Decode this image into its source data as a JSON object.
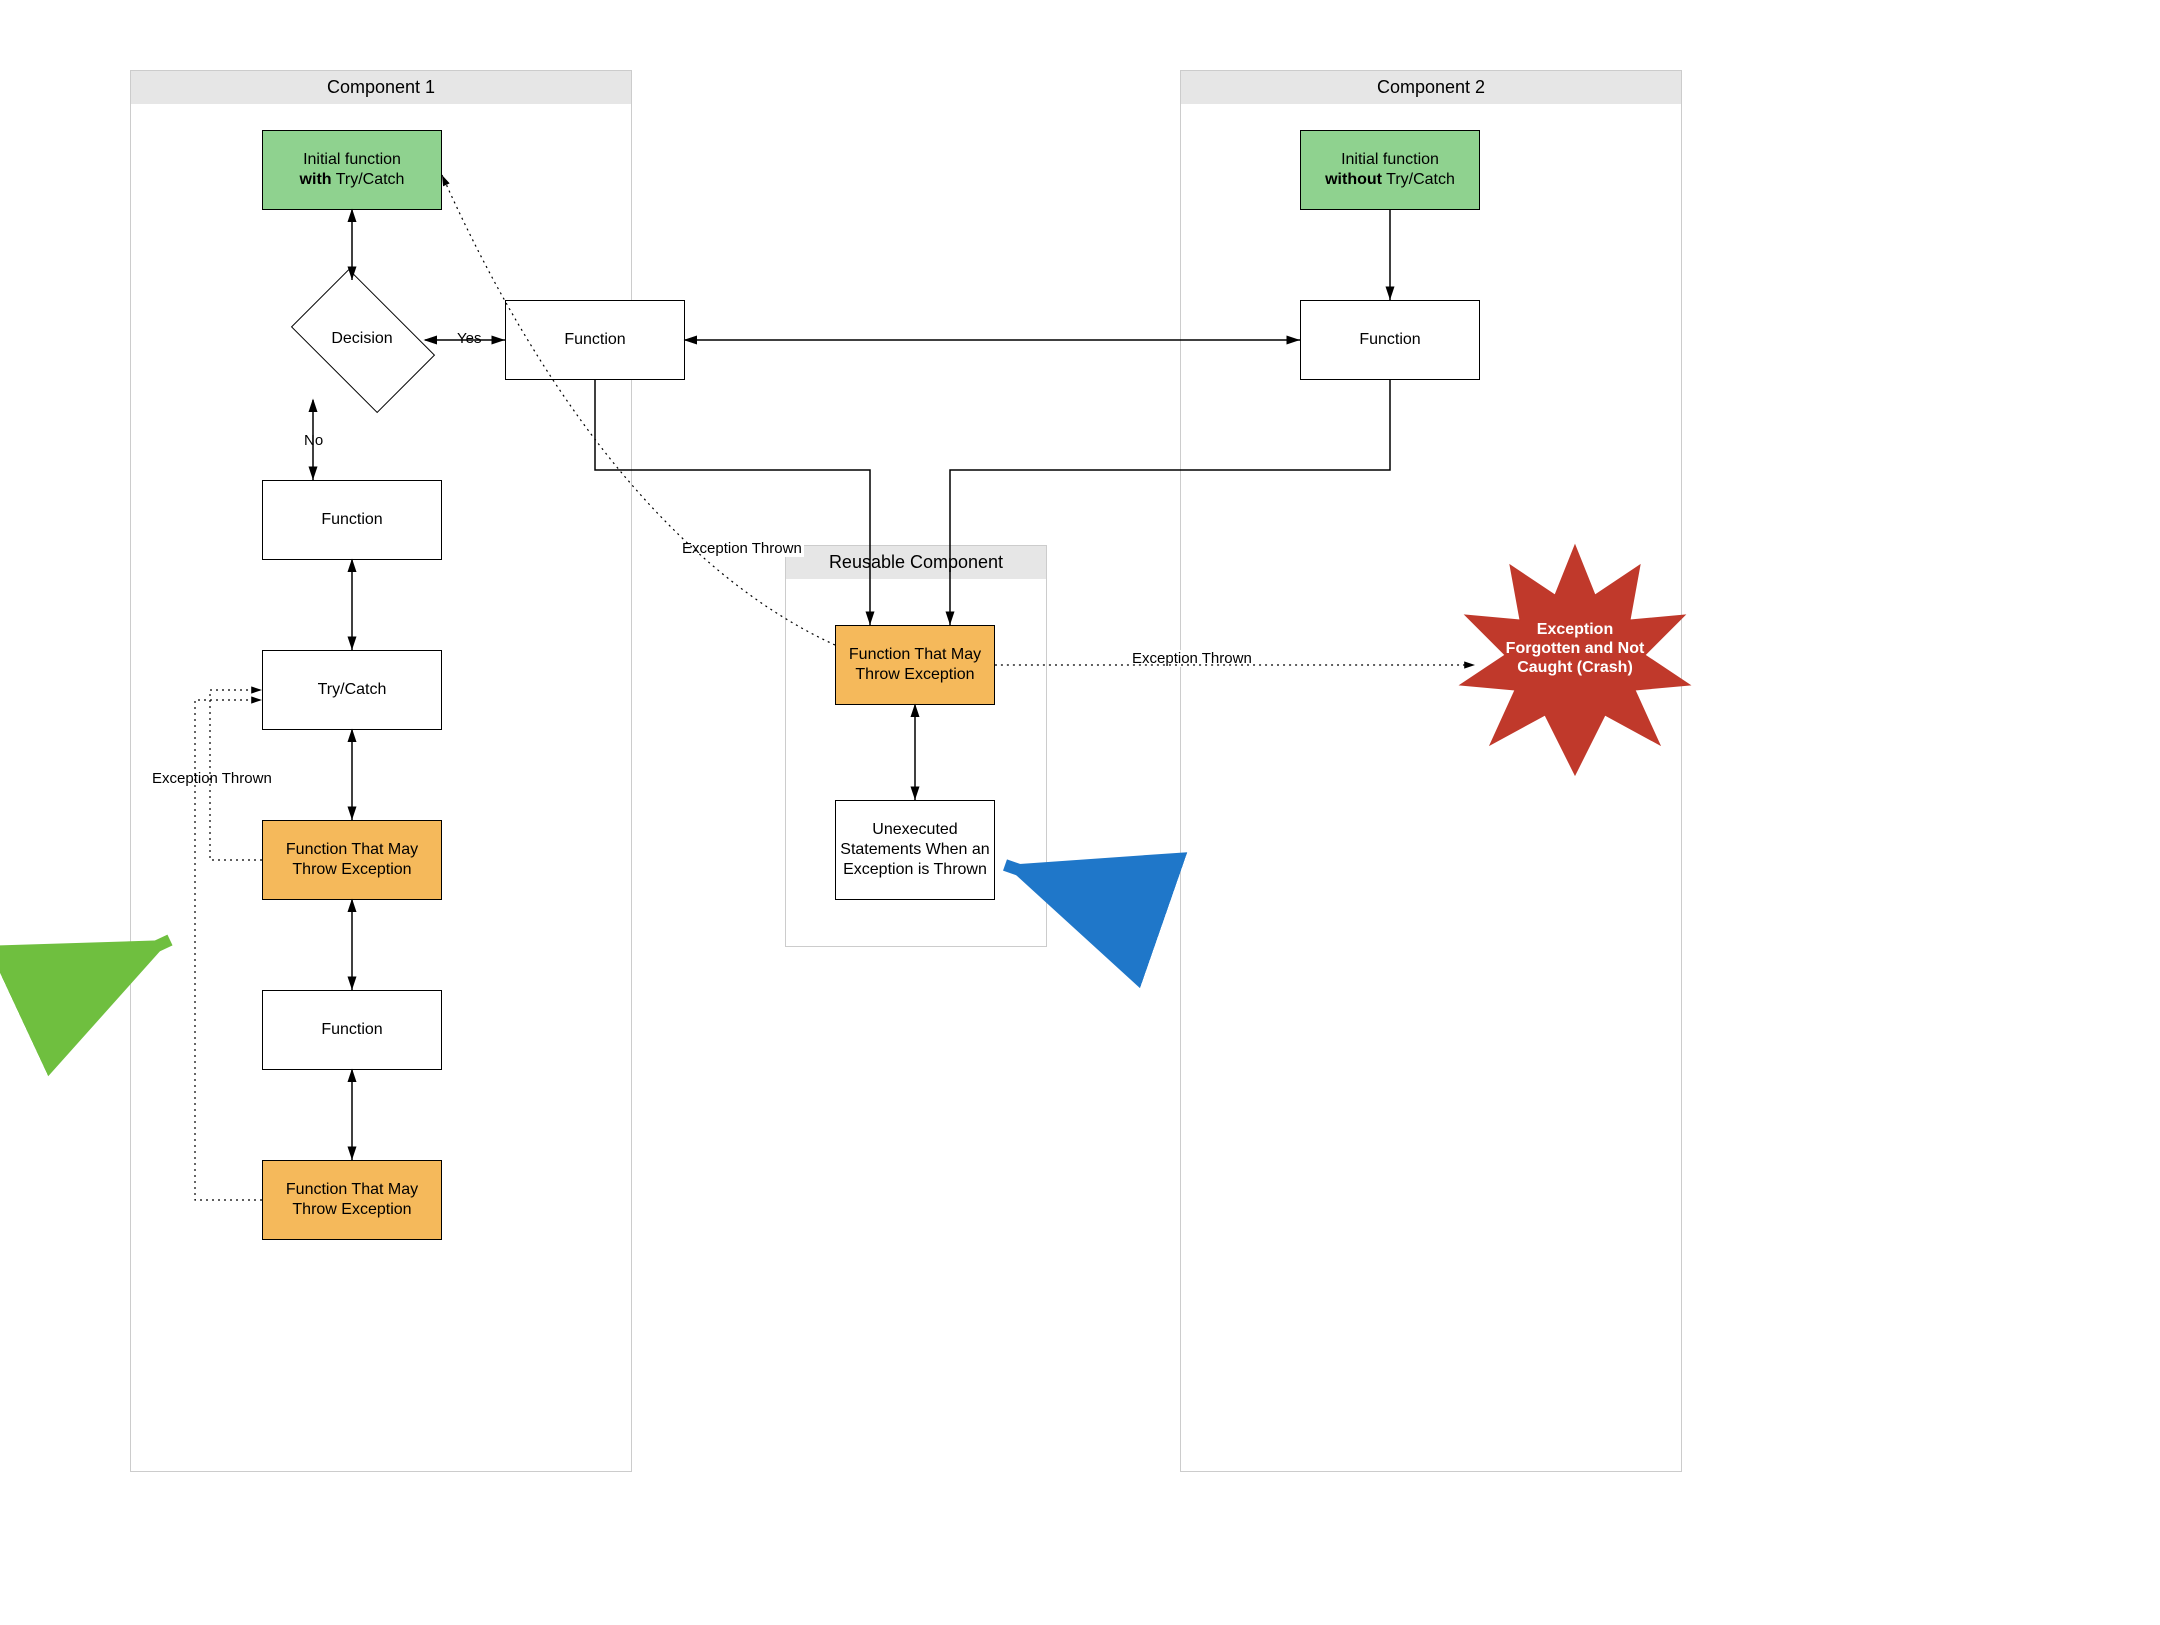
{
  "containers": {
    "component1_title": "Component 1",
    "component2_title": "Component 2",
    "reusable_title": "Reusable Component"
  },
  "nodes": {
    "c1_initial_prefix": "Initial function",
    "c1_initial_bold": "with",
    "c1_initial_suffix": " Try/Catch",
    "decision": "Decision",
    "c1_func_top": "Function",
    "c1_func_mid": "Function",
    "c1_trycatch": "Try/Catch",
    "c1_throw1": "Function That May Throw Exception",
    "c1_func_bot": "Function",
    "c1_throw2": "Function That May Throw Exception",
    "c2_initial_prefix": "Initial function",
    "c2_initial_bold": "without",
    "c2_initial_suffix": " Try/Catch",
    "c2_func": "Function",
    "rc_throw": "Function That May Throw Exception",
    "rc_unexec": "Unexecuted Statements When an Exception is Thrown",
    "crash": "Exception Forgotten and Not Caught (Crash)"
  },
  "labels": {
    "yes": "Yes",
    "no": "No",
    "ex_thrown_left": "Exception Thrown",
    "ex_thrown_mid": "Exception Thrown",
    "ex_thrown_right": "Exception Thrown"
  },
  "chart_data": {
    "type": "diagram",
    "title": "Exception handling flow across components",
    "containers": [
      {
        "id": "component1",
        "label": "Component 1"
      },
      {
        "id": "component2",
        "label": "Component 2"
      },
      {
        "id": "reusable",
        "label": "Reusable Component",
        "parent": null
      }
    ],
    "nodes": [
      {
        "id": "c1_initial",
        "container": "component1",
        "kind": "start",
        "label": "Initial function with Try/Catch",
        "color": "green"
      },
      {
        "id": "decision",
        "container": "component1",
        "kind": "decision",
        "label": "Decision"
      },
      {
        "id": "c1_func_top",
        "container": "component1",
        "kind": "process",
        "label": "Function"
      },
      {
        "id": "c1_func_mid",
        "container": "component1",
        "kind": "process",
        "label": "Function"
      },
      {
        "id": "c1_trycatch",
        "container": "component1",
        "kind": "process",
        "label": "Try/Catch"
      },
      {
        "id": "c1_throw1",
        "container": "component1",
        "kind": "process",
        "label": "Function That May Throw Exception",
        "color": "orange"
      },
      {
        "id": "c1_func_bot",
        "container": "component1",
        "kind": "process",
        "label": "Function"
      },
      {
        "id": "c1_throw2",
        "container": "component1",
        "kind": "process",
        "label": "Function That May Throw Exception",
        "color": "orange"
      },
      {
        "id": "c2_initial",
        "container": "component2",
        "kind": "start",
        "label": "Initial function without Try/Catch",
        "color": "green"
      },
      {
        "id": "c2_func",
        "container": "component2",
        "kind": "process",
        "label": "Function"
      },
      {
        "id": "rc_throw",
        "container": "reusable",
        "kind": "process",
        "label": "Function That May Throw Exception",
        "color": "orange"
      },
      {
        "id": "rc_unexec",
        "container": "reusable",
        "kind": "process",
        "label": "Unexecuted Statements When an Exception is Thrown"
      },
      {
        "id": "crash",
        "container": null,
        "kind": "terminal",
        "label": "Exception Forgotten and Not Caught (Crash)",
        "color": "red"
      }
    ],
    "edges": [
      {
        "from": "c1_initial",
        "to": "decision",
        "style": "solid",
        "bidirectional": true
      },
      {
        "from": "decision",
        "to": "c1_func_top",
        "style": "solid",
        "bidirectional": true,
        "label": "Yes"
      },
      {
        "from": "decision",
        "to": "c1_func_mid",
        "style": "solid",
        "bidirectional": true,
        "label": "No"
      },
      {
        "from": "c1_func_mid",
        "to": "c1_trycatch",
        "style": "solid",
        "bidirectional": true
      },
      {
        "from": "c1_trycatch",
        "to": "c1_throw1",
        "style": "solid",
        "bidirectional": true
      },
      {
        "from": "c1_throw1",
        "to": "c1_func_bot",
        "style": "solid",
        "bidirectional": true
      },
      {
        "from": "c1_func_bot",
        "to": "c1_throw2",
        "style": "solid",
        "bidirectional": true
      },
      {
        "from": "c1_throw1",
        "to": "c1_trycatch",
        "style": "dotted",
        "label": "Exception Thrown"
      },
      {
        "from": "c1_throw2",
        "to": "c1_trycatch",
        "style": "dotted",
        "label": "Exception Thrown"
      },
      {
        "from": "c1_func_top",
        "to": "rc_throw",
        "style": "solid"
      },
      {
        "from": "c2_initial",
        "to": "c2_func",
        "style": "solid"
      },
      {
        "from": "c2_func",
        "to": "c1_func_top",
        "style": "solid",
        "bidirectional": true
      },
      {
        "from": "c2_func",
        "to": "rc_throw",
        "style": "solid"
      },
      {
        "from": "rc_throw",
        "to": "rc_unexec",
        "style": "solid",
        "bidirectional": true
      },
      {
        "from": "rc_throw",
        "to": "c1_initial",
        "style": "dotted",
        "label": "Exception Thrown"
      },
      {
        "from": "rc_throw",
        "to": "crash",
        "style": "dotted",
        "label": "Exception Thrown"
      }
    ],
    "annotations": [
      {
        "kind": "arrow",
        "color": "green",
        "points_to": "c1_throw1/c1_trycatch region"
      },
      {
        "kind": "arrow",
        "color": "blue",
        "points_to": "rc_unexec"
      }
    ]
  }
}
